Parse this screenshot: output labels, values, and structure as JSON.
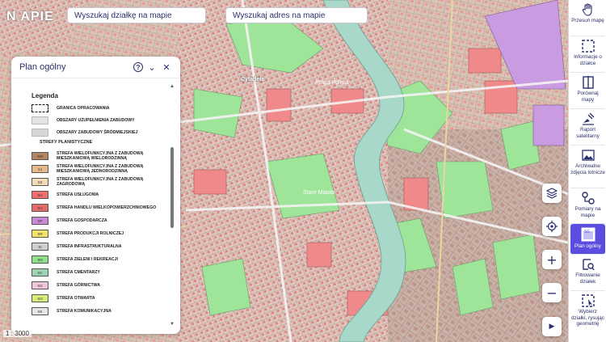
{
  "app": {
    "logo": "N  APIE"
  },
  "search": {
    "plot": "Wyszukaj działkę na mapie",
    "address": "Wyszukaj adres na mapie"
  },
  "map": {
    "labels": [
      "Cytadela",
      "Stare Miasto",
      "Praga Północ"
    ],
    "scale": "1 : 3000"
  },
  "panel": {
    "title": "Plan ogólny",
    "legend_title": "Legenda",
    "items": [
      {
        "code": "",
        "label": "GRANICA OPRACOWANIA"
      },
      {
        "code": "",
        "label": "OBSZARY UZUPEŁNIENIA ZABUDOWY"
      },
      {
        "code": "",
        "label": "OBSZARY ZABUDOWY ŚRÓDMIEJSKIEJ"
      },
      {
        "code": "",
        "label": "STREFY PLANISTYCZNE"
      },
      {
        "code": "SW",
        "label": "STREFA WIELOFUNKCYJNA Z ZABUDOWĄ MIESZKANIOWĄ WIELORODZINNĄ",
        "color": "#b28563"
      },
      {
        "code": "SJ",
        "label": "STREFA WIELOFUNKCYJNA Z ZABUDOWĄ MIESZKANIOWĄ JEDNORODZINNĄ",
        "color": "#e7b98c"
      },
      {
        "code": "SZ",
        "label": "STREFA WIELOFUNKCYJNA Z ZABUDOWĄ ZAGRODOWĄ",
        "color": "#f2dcb8"
      },
      {
        "code": "SU",
        "label": "STREFA USŁUGOWA",
        "color": "#f06e6e"
      },
      {
        "code": "SH",
        "label": "STREFA HANDLU WIELKOPOWIERZCHNIOWEGO",
        "color": "#e56a6a"
      },
      {
        "code": "SP",
        "label": "STREFA GOSPODARCZA",
        "color": "#c88ad6"
      },
      {
        "code": "SR",
        "label": "STREFA PRODUKCJI ROLNICZEJ",
        "color": "#f3e36a"
      },
      {
        "code": "SI",
        "label": "STREFA INFRASTRUKTURALNA",
        "color": "#cfcfcf"
      },
      {
        "code": "SN",
        "label": "STREFA ZIELENI I REKREACJI",
        "color": "#8fe08a"
      },
      {
        "code": "SC",
        "label": "STREFA CMENTARZY",
        "color": "#9ed4b4"
      },
      {
        "code": "SG",
        "label": "STREFA GÓRNICTWA",
        "color": "#f0c6dc"
      },
      {
        "code": "SO",
        "label": "STREFA OTWARTA",
        "color": "#d6ef7a"
      },
      {
        "code": "SK",
        "label": "STREFA KOMUNIKACYJNA",
        "color": "#e6e6e6"
      }
    ]
  },
  "sidebar": [
    {
      "label": "Przesuń mapę",
      "icon": "hand-icon"
    },
    {
      "label": "Informacje o działce",
      "icon": "plot-info-icon"
    },
    {
      "label": "Porównaj mapy",
      "icon": "compare-icon"
    },
    {
      "label": "Raport satelitarny",
      "icon": "satellite-icon"
    },
    {
      "label": "Archiwalne zdjęcia lotnicze",
      "icon": "image-icon"
    },
    {
      "label": "Pomiary na mapie",
      "icon": "measure-icon"
    },
    {
      "label": "Plan ogólny",
      "icon": "plan-icon",
      "badge": "SG",
      "active": true
    },
    {
      "label": "Filtrowanie działek",
      "icon": "filter-icon"
    },
    {
      "label": "Wybierz działki, rysując geometrię",
      "icon": "draw-select-icon"
    }
  ],
  "colors": {
    "accent": "#5b4de0",
    "text": "#2b2f6b",
    "river": "#9fd0c2",
    "green": "#8fe08a",
    "service": "#ee8a8a"
  }
}
